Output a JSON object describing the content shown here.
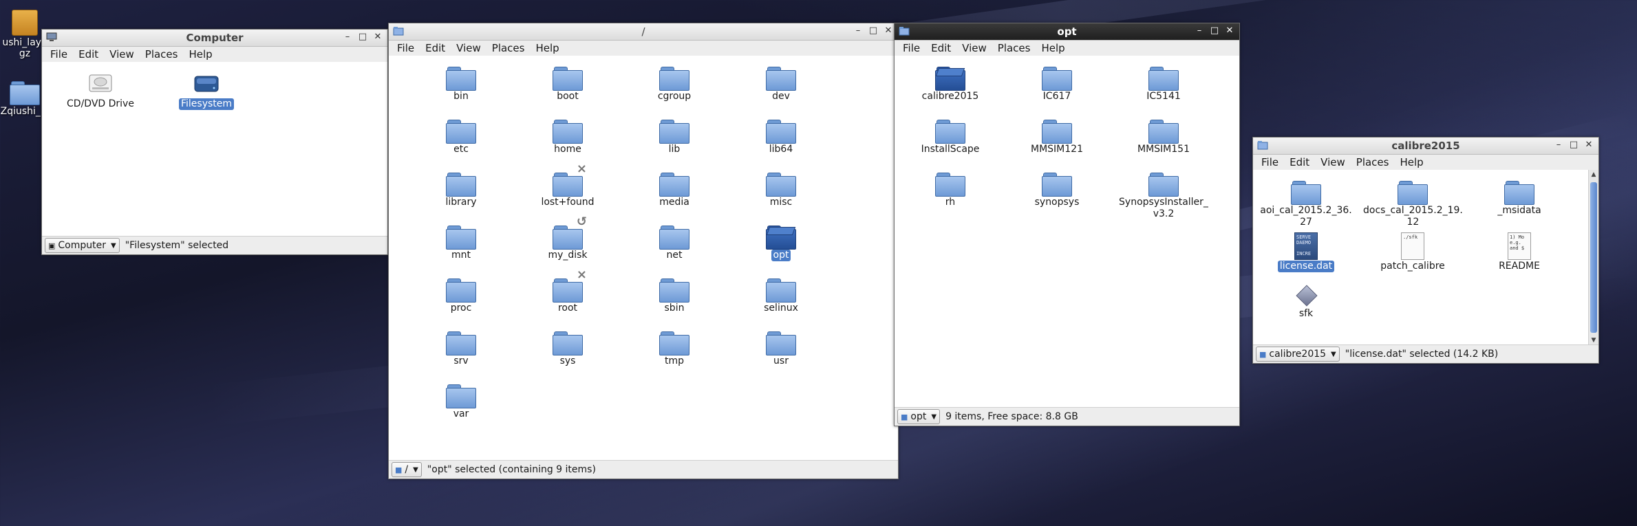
{
  "desktop": {
    "icons": [
      {
        "label": "ushi_layo\ngz"
      },
      {
        "label": "Zqiushi_la"
      }
    ]
  },
  "colors": {
    "selection": "#4a7cc7",
    "folder": "#6e9ad6",
    "active_titlebar": "#1f1f1f"
  },
  "computer_window": {
    "title": "Computer",
    "menu": [
      "File",
      "Edit",
      "View",
      "Places",
      "Help"
    ],
    "items": [
      {
        "label": "CD/DVD Drive",
        "icon": "optical-drive-icon",
        "selected": false
      },
      {
        "label": "Filesystem",
        "icon": "harddisk-icon",
        "selected": true
      }
    ],
    "location": "Computer",
    "status": "\"Filesystem\" selected"
  },
  "root_window": {
    "title": "/",
    "menu": [
      "File",
      "Edit",
      "View",
      "Places",
      "Help"
    ],
    "items": [
      {
        "label": "bin"
      },
      {
        "label": "boot"
      },
      {
        "label": "cgroup"
      },
      {
        "label": "dev"
      },
      {
        "label": "etc"
      },
      {
        "label": "home"
      },
      {
        "label": "lib"
      },
      {
        "label": "lib64"
      },
      {
        "label": "library"
      },
      {
        "label": "lost+found",
        "emblem": "×"
      },
      {
        "label": "media"
      },
      {
        "label": "misc"
      },
      {
        "label": "mnt"
      },
      {
        "label": "my_disk",
        "emblem": "↺"
      },
      {
        "label": "net"
      },
      {
        "label": "opt",
        "selected": true
      },
      {
        "label": "proc"
      },
      {
        "label": "root",
        "emblem": "×"
      },
      {
        "label": "sbin"
      },
      {
        "label": "selinux"
      },
      {
        "label": "srv"
      },
      {
        "label": "sys"
      },
      {
        "label": "tmp"
      },
      {
        "label": "usr"
      },
      {
        "label": "var"
      }
    ],
    "location": "/",
    "status": "\"opt\" selected (containing 9 items)"
  },
  "opt_window": {
    "title": "opt",
    "menu": [
      "File",
      "Edit",
      "View",
      "Places",
      "Help"
    ],
    "items": [
      {
        "label": "calibre2015",
        "open": true
      },
      {
        "label": "IC617"
      },
      {
        "label": "IC5141"
      },
      {
        "label": "InstallScape"
      },
      {
        "label": "MMSIM121"
      },
      {
        "label": "MMSIM151"
      },
      {
        "label": "rh"
      },
      {
        "label": "synopsys"
      },
      {
        "label": "SynopsysInstaller_\nv3.2"
      }
    ],
    "location": "opt",
    "status": "9 items, Free space: 8.8 GB"
  },
  "calibre_window": {
    "title": "calibre2015",
    "menu": [
      "File",
      "Edit",
      "View",
      "Places",
      "Help"
    ],
    "items": [
      {
        "label": "aoi_cal_2015.2_36.\n27",
        "kind": "folder"
      },
      {
        "label": "docs_cal_2015.2_19.\n12",
        "kind": "folder"
      },
      {
        "label": "_msidata",
        "kind": "folder"
      },
      {
        "label": "license.dat",
        "kind": "dat",
        "selected": true,
        "preview": "SERVE\nDAEMO\n\nINCRE"
      },
      {
        "label": "patch_calibre",
        "kind": "script",
        "preview": "./sfk"
      },
      {
        "label": "README",
        "kind": "text",
        "preview": "1) Mo\ne.g.\nand $"
      },
      {
        "label": "sfk",
        "kind": "binary"
      }
    ],
    "location": "calibre2015",
    "status": "\"license.dat\" selected (14.2 KB)"
  }
}
